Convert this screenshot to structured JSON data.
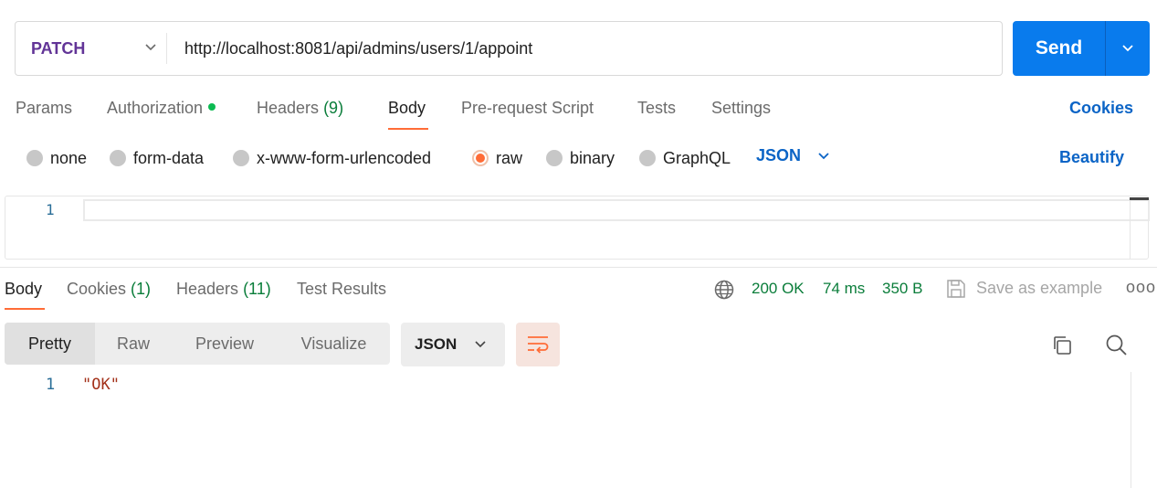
{
  "request": {
    "method": "PATCH",
    "url": "http://localhost:8081/api/admins/users/1/appoint",
    "send_label": "Send"
  },
  "request_tabs": [
    {
      "label": "Params"
    },
    {
      "label": "Authorization"
    },
    {
      "label": "Headers",
      "count": "(9)"
    },
    {
      "label": "Body"
    },
    {
      "label": "Pre-request Script"
    },
    {
      "label": "Tests"
    },
    {
      "label": "Settings"
    }
  ],
  "cookies_link": "Cookies",
  "body_types": [
    "none",
    "form-data",
    "x-www-form-urlencoded",
    "raw",
    "binary",
    "GraphQL"
  ],
  "body_format": "JSON",
  "beautify_label": "Beautify",
  "request_editor": {
    "line_number": "1"
  },
  "response_tabs": [
    {
      "label": "Body"
    },
    {
      "label": "Cookies",
      "count": "(1)"
    },
    {
      "label": "Headers",
      "count": "(11)"
    },
    {
      "label": "Test Results"
    }
  ],
  "response_meta": {
    "status": "200 OK",
    "time": "74 ms",
    "size": "350 B"
  },
  "save_example_label": "Save as example",
  "more_label": "ooo",
  "view_modes": [
    "Pretty",
    "Raw",
    "Preview",
    "Visualize"
  ],
  "response_format": "JSON",
  "response_body": {
    "line_number": "1",
    "content": "\"OK\""
  },
  "colors": {
    "accent": "#ff6c37",
    "send": "#097bed",
    "link": "#0b64c6",
    "status": "#0a7d3a",
    "method": "#623497"
  }
}
